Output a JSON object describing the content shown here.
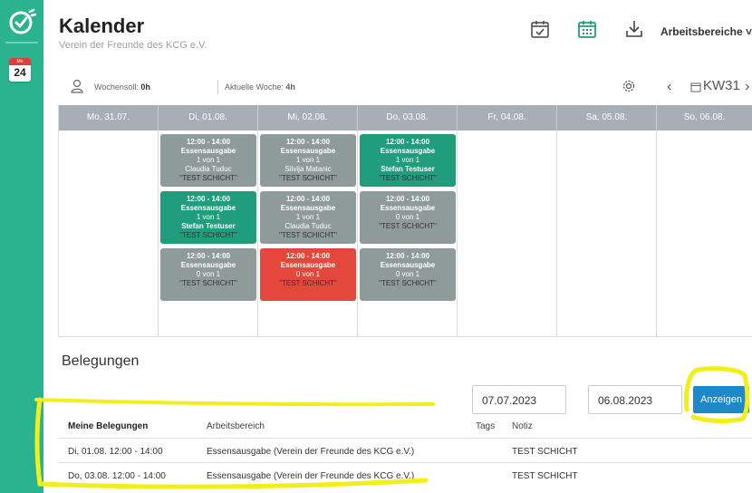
{
  "sidebar": {
    "calendar_badge_month": "Mo",
    "calendar_badge_day": "24"
  },
  "header": {
    "title": "Kalender",
    "subtitle": "Verein der Freunde des KCG e.V.",
    "workspace_label": "Arbeitsbereiche ˅"
  },
  "toolbar": {
    "wochensoll_label": "Wochensoll: ",
    "wochensoll_value": "0h",
    "aktuelle_woche_label": "Aktuelle Woche: ",
    "aktuelle_woche_value": "4h",
    "prev": "‹",
    "week": "KW31",
    "next": "›"
  },
  "calendar": {
    "days": [
      "Mo, 31.07.",
      "Di, 01.08.",
      "Mi, 02.08.",
      "Do, 03.08.",
      "Fr, 04.08.",
      "Sa, 05.08.",
      "So, 06.08."
    ],
    "shifts": [
      {
        "day": 1,
        "slot": 0,
        "status": "gray",
        "time": "12:00 - 14:00",
        "title": "Essensausgabe",
        "count": "1 von 1",
        "person": "Claudia Tuduc",
        "note": "\"TEST SCHICHT\""
      },
      {
        "day": 1,
        "slot": 1,
        "status": "green",
        "time": "12:00 - 14:00",
        "title": "Essensausgabe",
        "count": "1 von 1",
        "person": "Stefan Testuser",
        "note": "\"TEST SCHICHT\""
      },
      {
        "day": 1,
        "slot": 2,
        "status": "gray",
        "time": "12:00 - 14:00",
        "title": "Essensausgabe",
        "count": "0 von 1",
        "person": "",
        "note": "\"TEST SCHICHT\""
      },
      {
        "day": 2,
        "slot": 0,
        "status": "gray",
        "time": "12:00 - 14:00",
        "title": "Essensausgabe",
        "count": "1 von 1",
        "person": "Silvija Matanic",
        "note": "\"TEST SCHICHT\""
      },
      {
        "day": 2,
        "slot": 1,
        "status": "gray",
        "time": "12:00 - 14:00",
        "title": "Essensausgabe",
        "count": "1 von 1",
        "person": "Claudia Tuduc",
        "note": "\"TEST SCHICHT\""
      },
      {
        "day": 2,
        "slot": 2,
        "status": "red",
        "time": "12:00 - 14:00",
        "title": "Essensausgabe",
        "count": "0 von 1",
        "person": "",
        "note": "\"TEST SCHICHT\""
      },
      {
        "day": 3,
        "slot": 0,
        "status": "green",
        "time": "12:00 - 14:00",
        "title": "Essensausgabe",
        "count": "1 von 1",
        "person": "Stefan Testuser",
        "note": "\"TEST SCHICHT\""
      },
      {
        "day": 3,
        "slot": 1,
        "status": "gray",
        "time": "12:00 - 14:00",
        "title": "Essensausgabe",
        "count": "0 von 1",
        "person": "",
        "note": "\"TEST SCHICHT\""
      },
      {
        "day": 3,
        "slot": 2,
        "status": "gray",
        "time": "12:00 - 14:00",
        "title": "Essensausgabe",
        "count": "0 von 1",
        "person": "",
        "note": "\"TEST SCHICHT\""
      }
    ]
  },
  "belegungen": {
    "title": "Belegungen",
    "date_from": "07.07.2023",
    "date_to": "06.08.2023",
    "show_button": "Anzeigen",
    "columns": [
      "Meine Belegungen",
      "Arbeitsbereich",
      "Tags",
      "Notiz"
    ],
    "rows": [
      {
        "date": "Di, 01.08. 12:00 - 14:00",
        "area": "Essensausgabe (Verein der Freunde des KCG e.V.)",
        "tags": "",
        "note": "TEST SCHICHT"
      },
      {
        "date": "Do, 03.08. 12:00 - 14:00",
        "area": "Essensausgabe (Verein der Freunde des KCG e.V.)",
        "tags": "",
        "note": "TEST SCHICHT"
      }
    ]
  },
  "colors": {
    "sidebar": "#2bb38f",
    "shift_gray": "#8f9a9b",
    "shift_green": "#1f9d7c",
    "shift_red": "#e4473b",
    "button_blue": "#1e88c8",
    "highlight": "#f2ee1b"
  }
}
